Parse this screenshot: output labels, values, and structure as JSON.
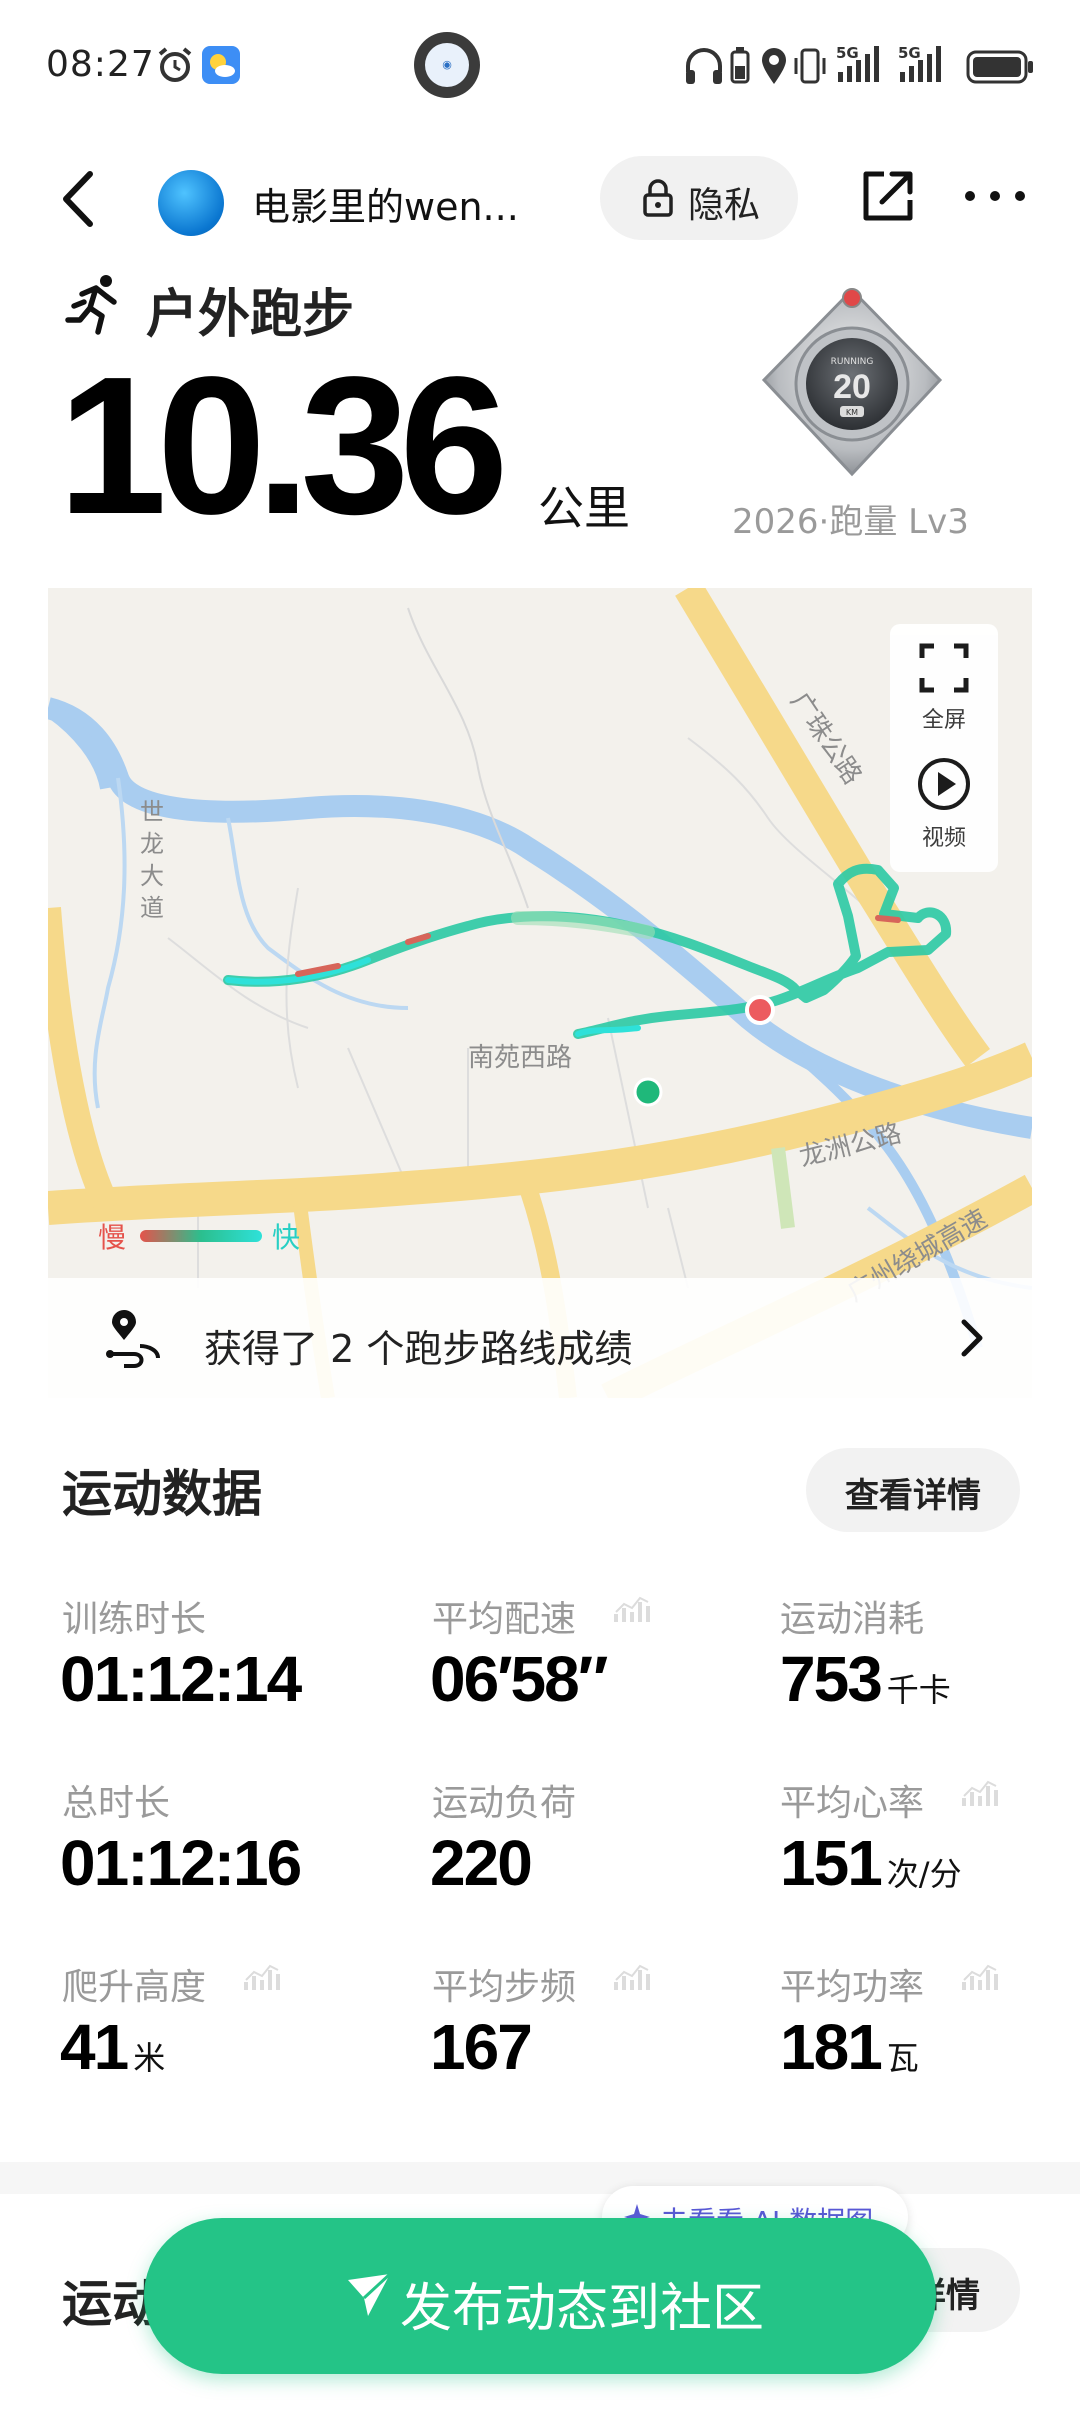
{
  "status_bar": {
    "time": "08:27"
  },
  "nav": {
    "user_name": "电影里的wen...",
    "privacy_label": "隐私"
  },
  "header": {
    "activity_type": "户外跑步",
    "distance": "10.36",
    "distance_unit": "公里",
    "badge_caption": "2026·跑量 Lv3",
    "badge_number": "20",
    "badge_top_text": "RUNNING",
    "badge_bottom_text": "KM"
  },
  "map": {
    "fullscreen_label": "全屏",
    "video_label": "视频",
    "road_labels": [
      "世龙大道",
      "南苑西路",
      "龙洲公路",
      "广珠公路",
      "广州绕城高速"
    ],
    "legend_slow": "慢",
    "legend_fast": "快",
    "route_banner_text": "获得了 2 个跑步路线成绩"
  },
  "stats": {
    "title": "运动数据",
    "details_label": "查看详情",
    "items": [
      {
        "label": "训练时长",
        "value": "01:12:14",
        "unit": ""
      },
      {
        "label": "平均配速",
        "value": "06′58″",
        "unit": ""
      },
      {
        "label": "运动消耗",
        "value": "753",
        "unit": "千卡"
      },
      {
        "label": "总时长",
        "value": "01:12:16",
        "unit": ""
      },
      {
        "label": "运动负荷",
        "value": "220",
        "unit": ""
      },
      {
        "label": "平均心率",
        "value": "151",
        "unit": "次/分"
      },
      {
        "label": "爬升高度",
        "value": "41",
        "unit": "米"
      },
      {
        "label": "平均步频",
        "value": "167",
        "unit": ""
      },
      {
        "label": "平均功率",
        "value": "181",
        "unit": "瓦"
      }
    ]
  },
  "section2": {
    "title": "运动",
    "details_label": "详情"
  },
  "ai_pill": {
    "label": "去看看 AI 数据图"
  },
  "publish": {
    "label": "发布动态到社区"
  },
  "colors": {
    "accent_green": "#24c487",
    "route_fast": "#2ee1d9",
    "route_slow": "#e5534b",
    "road_yellow": "#f6d98a",
    "water_blue": "#a9cdf0"
  }
}
